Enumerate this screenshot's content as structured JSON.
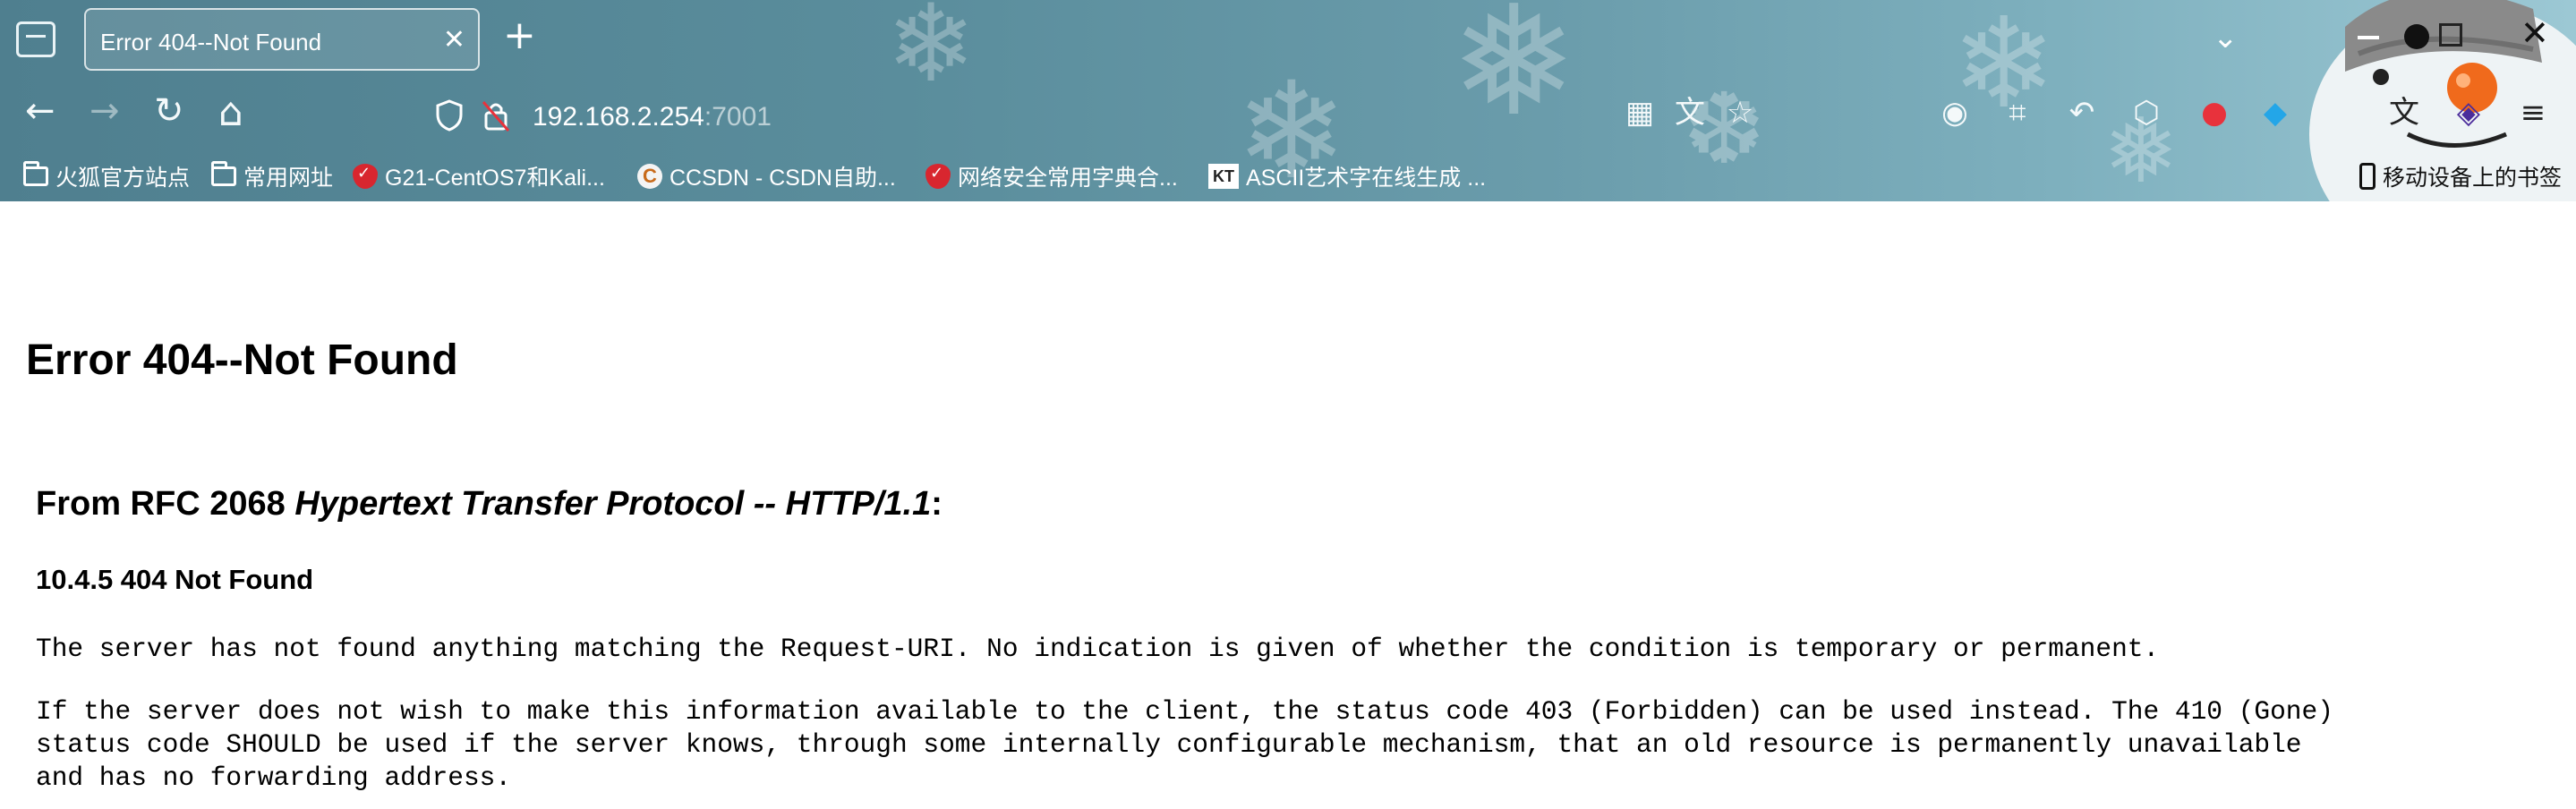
{
  "browser": {
    "tab": {
      "title": "Error 404--Not Found",
      "close_glyph": "✕"
    },
    "new_tab_glyph": "+",
    "tab_overflow_glyph": "⌄",
    "window_close_glyph": "✕",
    "nav": {
      "back_glyph": "←",
      "forward_glyph": "→",
      "reload_glyph": "↻",
      "home_glyph": "⌂"
    },
    "url": {
      "host": "192.168.2.254",
      "port": ":7001"
    },
    "bookmarks": [
      {
        "label": "火狐官方站点",
        "icon": "folder-icon"
      },
      {
        "label": "常用网址",
        "icon": "folder-icon"
      },
      {
        "label": "G21-CentOS7和Kali...",
        "icon": "shield-icon"
      },
      {
        "label": "CCSDN - CSDN自助...",
        "icon": "csdn-icon"
      },
      {
        "label": "网络安全常用字典合...",
        "icon": "shield-icon"
      },
      {
        "label": "ASCII艺术字在线生成 ...",
        "icon": "kt-icon"
      },
      {
        "label": "移动设备上的书签",
        "icon": "mobile-icon"
      }
    ],
    "kt_icon_text": "KT",
    "csdn_icon_text": "C"
  },
  "page": {
    "heading": "Error 404--Not Found",
    "rfc_prefix": "From RFC 2068 ",
    "rfc_title": "Hypertext Transfer Protocol -- HTTP/1.1",
    "rfc_suffix": ":",
    "section": "10.4.5 404 Not Found",
    "para1": "The server has not found anything matching the Request-URI. No indication is given of whether the condition is temporary or permanent.",
    "para2_line1": "If the server does not wish to make this information available to the client, the status code 403 (Forbidden) can be used instead. The 410 (Gone)",
    "para2_line2": "status code SHOULD be used if the server knows, through some internally configurable mechanism, that an old resource is permanently unavailable",
    "para2_line3": "and has no forwarding address."
  },
  "colors": {
    "chrome_start": "#4f7f8f",
    "chrome_end": "#9cc8d4",
    "text": "#000000"
  }
}
